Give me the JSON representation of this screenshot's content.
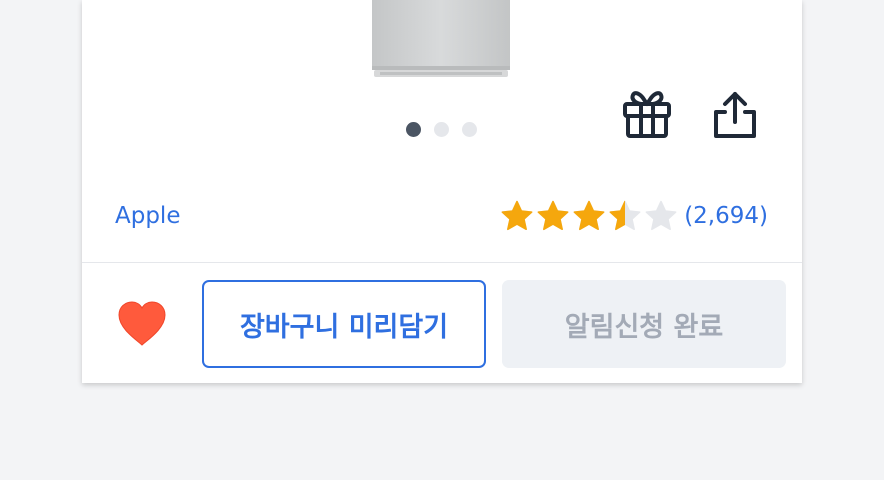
{
  "product": {
    "brand": "Apple",
    "rating": 3.5,
    "rating_max": 5,
    "review_count": "(2,694)"
  },
  "gallery": {
    "image_count": 3,
    "active_index": 0
  },
  "actions": {
    "cart_label": "장바구니 미리담기",
    "notify_label": "알림신청 완료",
    "wishlisted": true
  },
  "colors": {
    "accent": "#2f6fe0",
    "star_filled": "#f5a70d",
    "star_empty": "#e5e7eb",
    "heart": "#ff5a3c"
  },
  "icons": [
    "gift-icon",
    "share-icon",
    "heart-icon",
    "star-icon"
  ]
}
